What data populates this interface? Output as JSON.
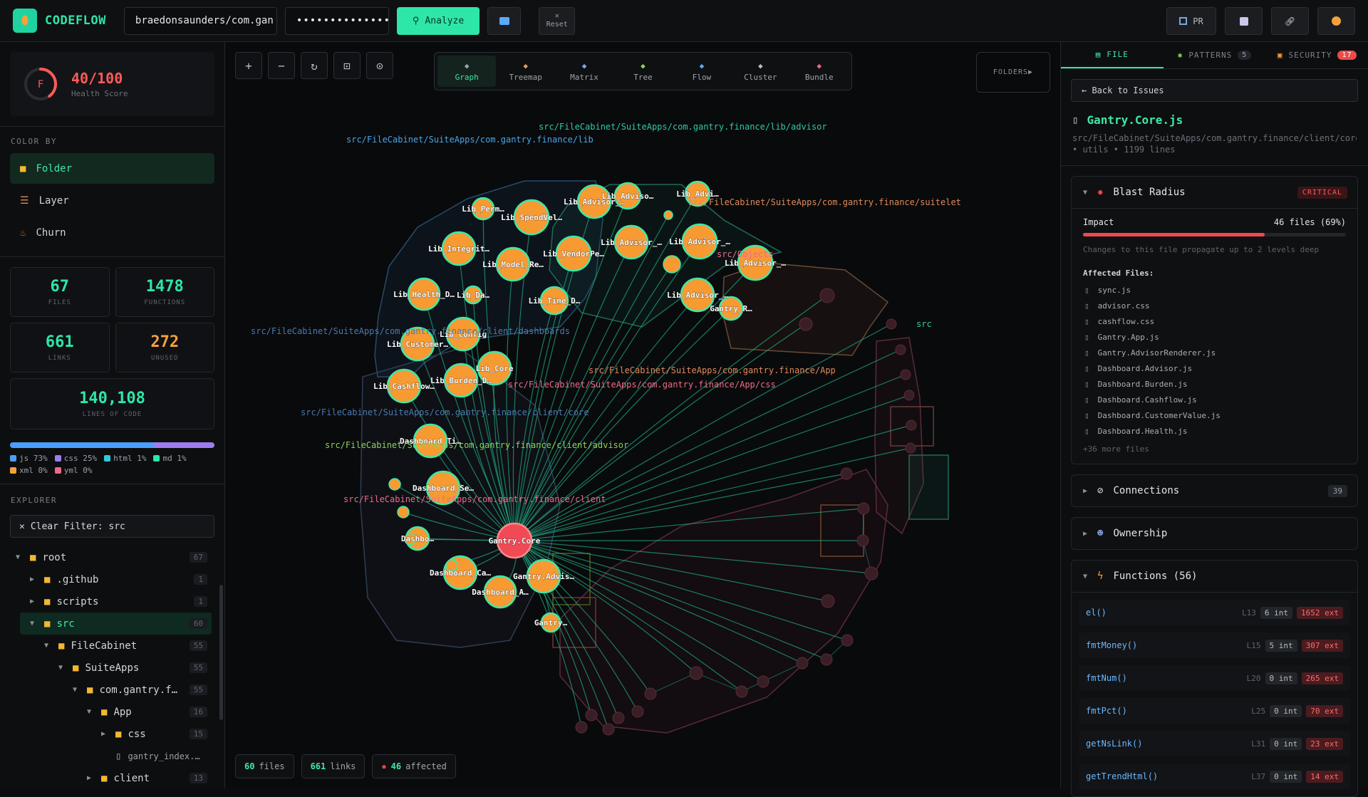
{
  "app": {
    "name": "CODEFLOW"
  },
  "toolbar": {
    "repo_value": "braedonsaunders/com.gan",
    "token_value": "••••••••••••••",
    "analyze_label": "Analyze",
    "reset_label": "Reset",
    "pr_label": "PR"
  },
  "sidebar": {
    "health_grade": "F",
    "health_score": "40/100",
    "health_label": "Health Score",
    "health_fraction": 0.4,
    "color_by_label": "COLOR BY",
    "color_by": [
      {
        "label": "Folder",
        "icon": "folder-icon"
      },
      {
        "label": "Layer",
        "icon": "layer-icon"
      },
      {
        "label": "Churn",
        "icon": "flame-icon"
      }
    ],
    "stats": {
      "files": "67",
      "files_label": "FILES",
      "functions": "1478",
      "functions_label": "FUNCTIONS",
      "links": "661",
      "links_label": "LINKS",
      "unused": "272",
      "unused_label": "UNUSED",
      "loc": "140,108",
      "loc_label": "LINES OF CODE"
    },
    "languages": [
      {
        "label": "js 73%",
        "color": "#4a9eff"
      },
      {
        "label": "css 25%",
        "color": "#9d7cf0"
      },
      {
        "label": "html 1%",
        "color": "#2ec9e0"
      },
      {
        "label": "md 1%",
        "color": "#2ee6a8"
      },
      {
        "label": "xml 0%",
        "color": "#f6a13a"
      },
      {
        "label": "yml 0%",
        "color": "#ef6a8a"
      }
    ],
    "explorer_label": "EXPLORER",
    "filter_label": "Clear Filter: src",
    "tree": [
      {
        "label": "root",
        "count": "67"
      },
      {
        "label": ".github",
        "count": "1"
      },
      {
        "label": "scripts",
        "count": "1"
      },
      {
        "label": "src",
        "count": "60"
      },
      {
        "label": "FileCabinet",
        "count": "55"
      },
      {
        "label": "SuiteApps",
        "count": "55"
      },
      {
        "label": "com.gantry.f…",
        "count": "55"
      },
      {
        "label": "App",
        "count": "16"
      },
      {
        "label": "css",
        "count": "15"
      },
      {
        "label": "gantry_index.…",
        "count": ""
      },
      {
        "label": "client",
        "count": "13"
      }
    ]
  },
  "canvas": {
    "views": [
      {
        "label": "Graph",
        "icon": "graph-icon"
      },
      {
        "label": "Treemap",
        "icon": "treemap-icon"
      },
      {
        "label": "Matrix",
        "icon": "matrix-icon"
      },
      {
        "label": "Tree",
        "icon": "tree-icon"
      },
      {
        "label": "Flow",
        "icon": "flow-icon"
      },
      {
        "label": "Cluster",
        "icon": "cluster-icon"
      },
      {
        "label": "Bundle",
        "icon": "bundle-icon"
      }
    ],
    "folders_label": "FOLDERS▶",
    "pills": {
      "files_num": "60",
      "files_label": "files",
      "links_num": "661",
      "links_label": "links",
      "affected_num": "46",
      "affected_label": "affected"
    },
    "folder_labels": [
      "src/FileCabinet/SuiteApps/com.gantry.finance/lib/advisor",
      "src/FileCabinet/SuiteApps/com.gantry.finance/lib",
      "src/FileCabinet/SuiteApps/com.gantry.finance/suitelet",
      "src/Objects",
      "src/FileCabinet/SuiteApps/com.gantry.finance/client/dashboards",
      "src/FileCabinet/SuiteApps/com.gantry.finance/App",
      "src/FileCabinet/SuiteApps/com.gantry.finance/App/css",
      "src/FileCabinet/SuiteApps/com.gantry.finance/client/core",
      "src/FileCabinet/SuiteApps/com.gantry.finance/client/advisor",
      "src/FileCabinet/SuiteApps/com.gantry.finance/client",
      "src"
    ],
    "nodes": [
      "Lib_Perm…",
      "Lib_SpendVel…",
      "Lib_Advisor_…",
      "Lib_Adviso…",
      "Lib_Advi…",
      "Lib_Integrit…",
      "Lib_Model_Re…",
      "Lib_VendorPe…",
      "Lib_Advisor_…",
      "Lib_Advisor_…",
      "Lib_Advisor_…",
      "Lib_Health_D…",
      "Lib_Da…",
      "Lib_Time_D…",
      "Lib_Advisor_…",
      "Gantry_R…",
      "Lib_Config",
      "Lib_Customer…",
      "Lib_Core",
      "Lib_Burden_D…",
      "Lib_Cashflow…",
      "Dashboard_Ti…",
      "Dashboard_Se…",
      "Dashbo…",
      "Gantry.Core",
      "Dashboard_Ca…",
      "Dashboard_A…",
      "Gantry.Advis…",
      "Gantry…"
    ]
  },
  "panel": {
    "tabs": [
      {
        "label": "FILE",
        "badge": ""
      },
      {
        "label": "PATTERNS",
        "badge": "5"
      },
      {
        "label": "SECURITY",
        "badge": "17"
      }
    ],
    "back_label": "← Back to Issues",
    "file_name": "Gantry.Core.js",
    "file_path": "src/FileCabinet/SuiteApps/com.gantry.finance/client/core",
    "file_meta": "• utils • 1199 lines",
    "blast": {
      "title": "Blast Radius",
      "severity": "CRITICAL",
      "impact_label": "Impact",
      "impact_value": "46 files (69%)",
      "impact_fraction": 0.69,
      "note": "Changes to this file propagate up to 2 levels deep",
      "affected_title": "Affected Files:",
      "files": [
        "sync.js",
        "advisor.css",
        "cashflow.css",
        "Gantry.App.js",
        "Gantry.AdvisorRenderer.js",
        "Dashboard.Advisor.js",
        "Dashboard.Burden.js",
        "Dashboard.Cashflow.js",
        "Dashboard.CustomerValue.js",
        "Dashboard.Health.js"
      ],
      "more": "+36 more files"
    },
    "connections": {
      "title": "Connections",
      "count": "39"
    },
    "ownership": {
      "title": "Ownership"
    },
    "functions": {
      "title": "Functions (56)",
      "items": [
        {
          "name": "el()",
          "line": "L13",
          "int": "6 int",
          "ext": "1652 ext"
        },
        {
          "name": "fmtMoney()",
          "line": "L15",
          "int": "5 int",
          "ext": "307 ext"
        },
        {
          "name": "fmtNum()",
          "line": "L20",
          "int": "0 int",
          "ext": "265 ext"
        },
        {
          "name": "fmtPct()",
          "line": "L25",
          "int": "0 int",
          "ext": "70 ext"
        },
        {
          "name": "getNsLink()",
          "line": "L31",
          "int": "0 int",
          "ext": "23 ext"
        },
        {
          "name": "getTrendHtml()",
          "line": "L37",
          "int": "0 int",
          "ext": "14 ext"
        }
      ]
    }
  }
}
